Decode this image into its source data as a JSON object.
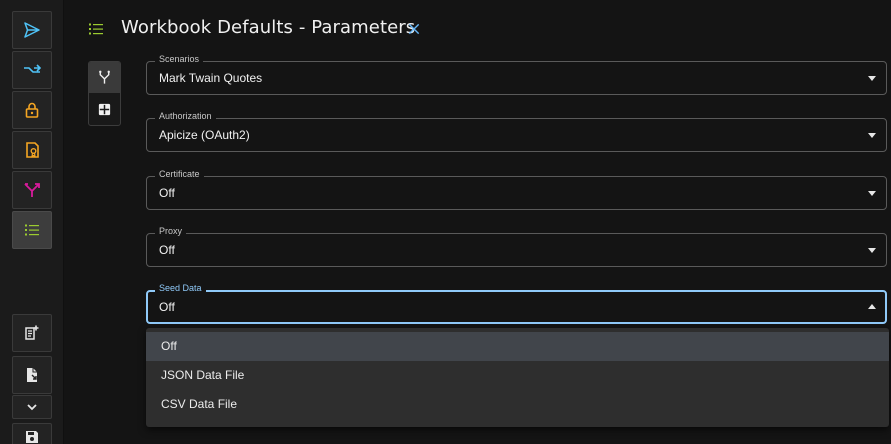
{
  "header": {
    "title": "Workbook Defaults - Parameters",
    "icon": "list-icon",
    "close_icon": "close-icon"
  },
  "rail": {
    "items": [
      {
        "icon": "send-icon",
        "color": "#4fc3f7"
      },
      {
        "icon": "merge-arrows-icon",
        "color": "#4fc3f7"
      },
      {
        "icon": "lock-icon",
        "color": "#f5a623"
      },
      {
        "icon": "certificate-icon",
        "color": "#f5a623"
      },
      {
        "icon": "split-arrows-icon",
        "color": "#d81b9c"
      },
      {
        "icon": "list-icon",
        "color": "#9ccc30",
        "active": true
      }
    ],
    "bottom": [
      {
        "icon": "new-note-icon"
      },
      {
        "icon": "import-file-icon"
      },
      {
        "icon": "chevron-down-icon"
      },
      {
        "icon": "save-icon"
      }
    ]
  },
  "toggles": [
    {
      "icon": "branch-icon",
      "selected": true
    },
    {
      "icon": "grid-icon",
      "selected": false
    }
  ],
  "fields": {
    "scenarios": {
      "label": "Scenarios",
      "value": "Mark Twain Quotes"
    },
    "authorization": {
      "label": "Authorization",
      "value": "Apicize (OAuth2)"
    },
    "certificate": {
      "label": "Certificate",
      "value": "Off"
    },
    "proxy": {
      "label": "Proxy",
      "value": "Off"
    },
    "seed_data": {
      "label": "Seed Data",
      "value": "Off"
    }
  },
  "seed_menu": {
    "options": [
      "Off",
      "JSON Data File",
      "CSV Data File"
    ],
    "selected": "Off"
  },
  "colors": {
    "accent_focus": "#90caf9",
    "background": "#141414",
    "menu_bg": "#2e2e2e"
  }
}
